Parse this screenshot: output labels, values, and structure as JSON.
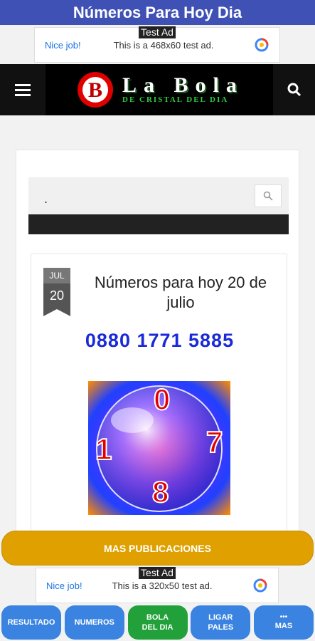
{
  "app_bar": {
    "title": "Números Para Hoy Dia"
  },
  "ad_top": {
    "tag": "Test Ad",
    "nice": "Nice job!",
    "text": "This is a 468x60 test ad."
  },
  "header": {
    "logo_main": "La Bola",
    "logo_sub": "DE CRISTAL DEL DIA"
  },
  "search": {
    "dot": "."
  },
  "post": {
    "month": "JUL",
    "day": "20",
    "title": "Números para hoy 20 de julio",
    "numbers": "0880 1771 5885",
    "ball_numbers": [
      "0",
      "1",
      "7",
      "8"
    ]
  },
  "mas_publicaciones": "MAS PUBLICACIONES",
  "ad_bottom": {
    "tag": "Test Ad",
    "nice": "Nice job!",
    "text": "This is a 320x50 test ad."
  },
  "nav": {
    "resultado": "RESULTADO",
    "numeros": "NUMEROS",
    "bola_line1": "BOLA",
    "bola_line2": "DEL DIA",
    "ligar_line1": "LIGAR",
    "ligar_line2": "PALES",
    "more_dots": "•••",
    "mas": "MAS"
  },
  "colors": {
    "app_bar": "#3f51b5",
    "mas_button": "#e0a000",
    "nav_blue": "#3a83e0",
    "nav_green": "#22a03a",
    "numbers": "#1a2ad8"
  }
}
